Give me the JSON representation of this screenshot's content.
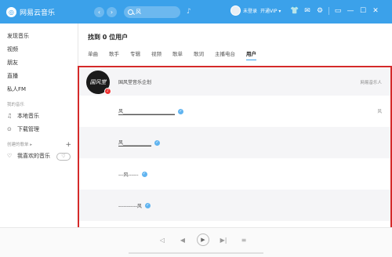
{
  "app": {
    "title": "网易云音乐",
    "logo_glyph": "◎"
  },
  "topbar": {
    "back": "‹",
    "forward": "›",
    "search_value": "风",
    "mic": "♪",
    "username": "未登录",
    "vip": "开通VIP ▾",
    "icons": [
      "👕",
      "✉",
      "⚙",
      "▭",
      "—",
      "☐",
      "✕"
    ]
  },
  "sidebar": {
    "items": [
      "发现音乐",
      "视频",
      "朋友",
      "直播",
      "私人FM"
    ],
    "my_music_title": "我的音乐",
    "my_music": [
      {
        "icon": "♫",
        "label": "本地音乐"
      },
      {
        "icon": "⊙",
        "label": "下载管理"
      }
    ],
    "created_title": "创建的歌单 ▸",
    "created_add": "+",
    "favorite": {
      "icon": "♡",
      "label": "我喜欢的音乐",
      "mode": "♡"
    }
  },
  "main": {
    "found": "找到 0 位用户",
    "tabs": [
      "单曲",
      "歌手",
      "专辑",
      "视频",
      "歌单",
      "歌词",
      "主播电台",
      "用户"
    ],
    "active_tab": "用户",
    "results": [
      {
        "name": "国风堂音乐企划",
        "right": "网易音乐人",
        "avatar_text": "国风堂"
      },
      {
        "name": "风______________________",
        "right": "风"
      },
      {
        "name": "风____________",
        "right": ""
      },
      {
        "name": "---风------",
        "right": ""
      },
      {
        "name": "-----------风",
        "right": ""
      }
    ]
  },
  "player": {
    "prev": "◁",
    "back": "◀",
    "play": "▶",
    "next": "▶|",
    "list": "≡"
  },
  "colors": {
    "accent": "#3ba1ea",
    "highlight_box": "#d42a2a"
  }
}
